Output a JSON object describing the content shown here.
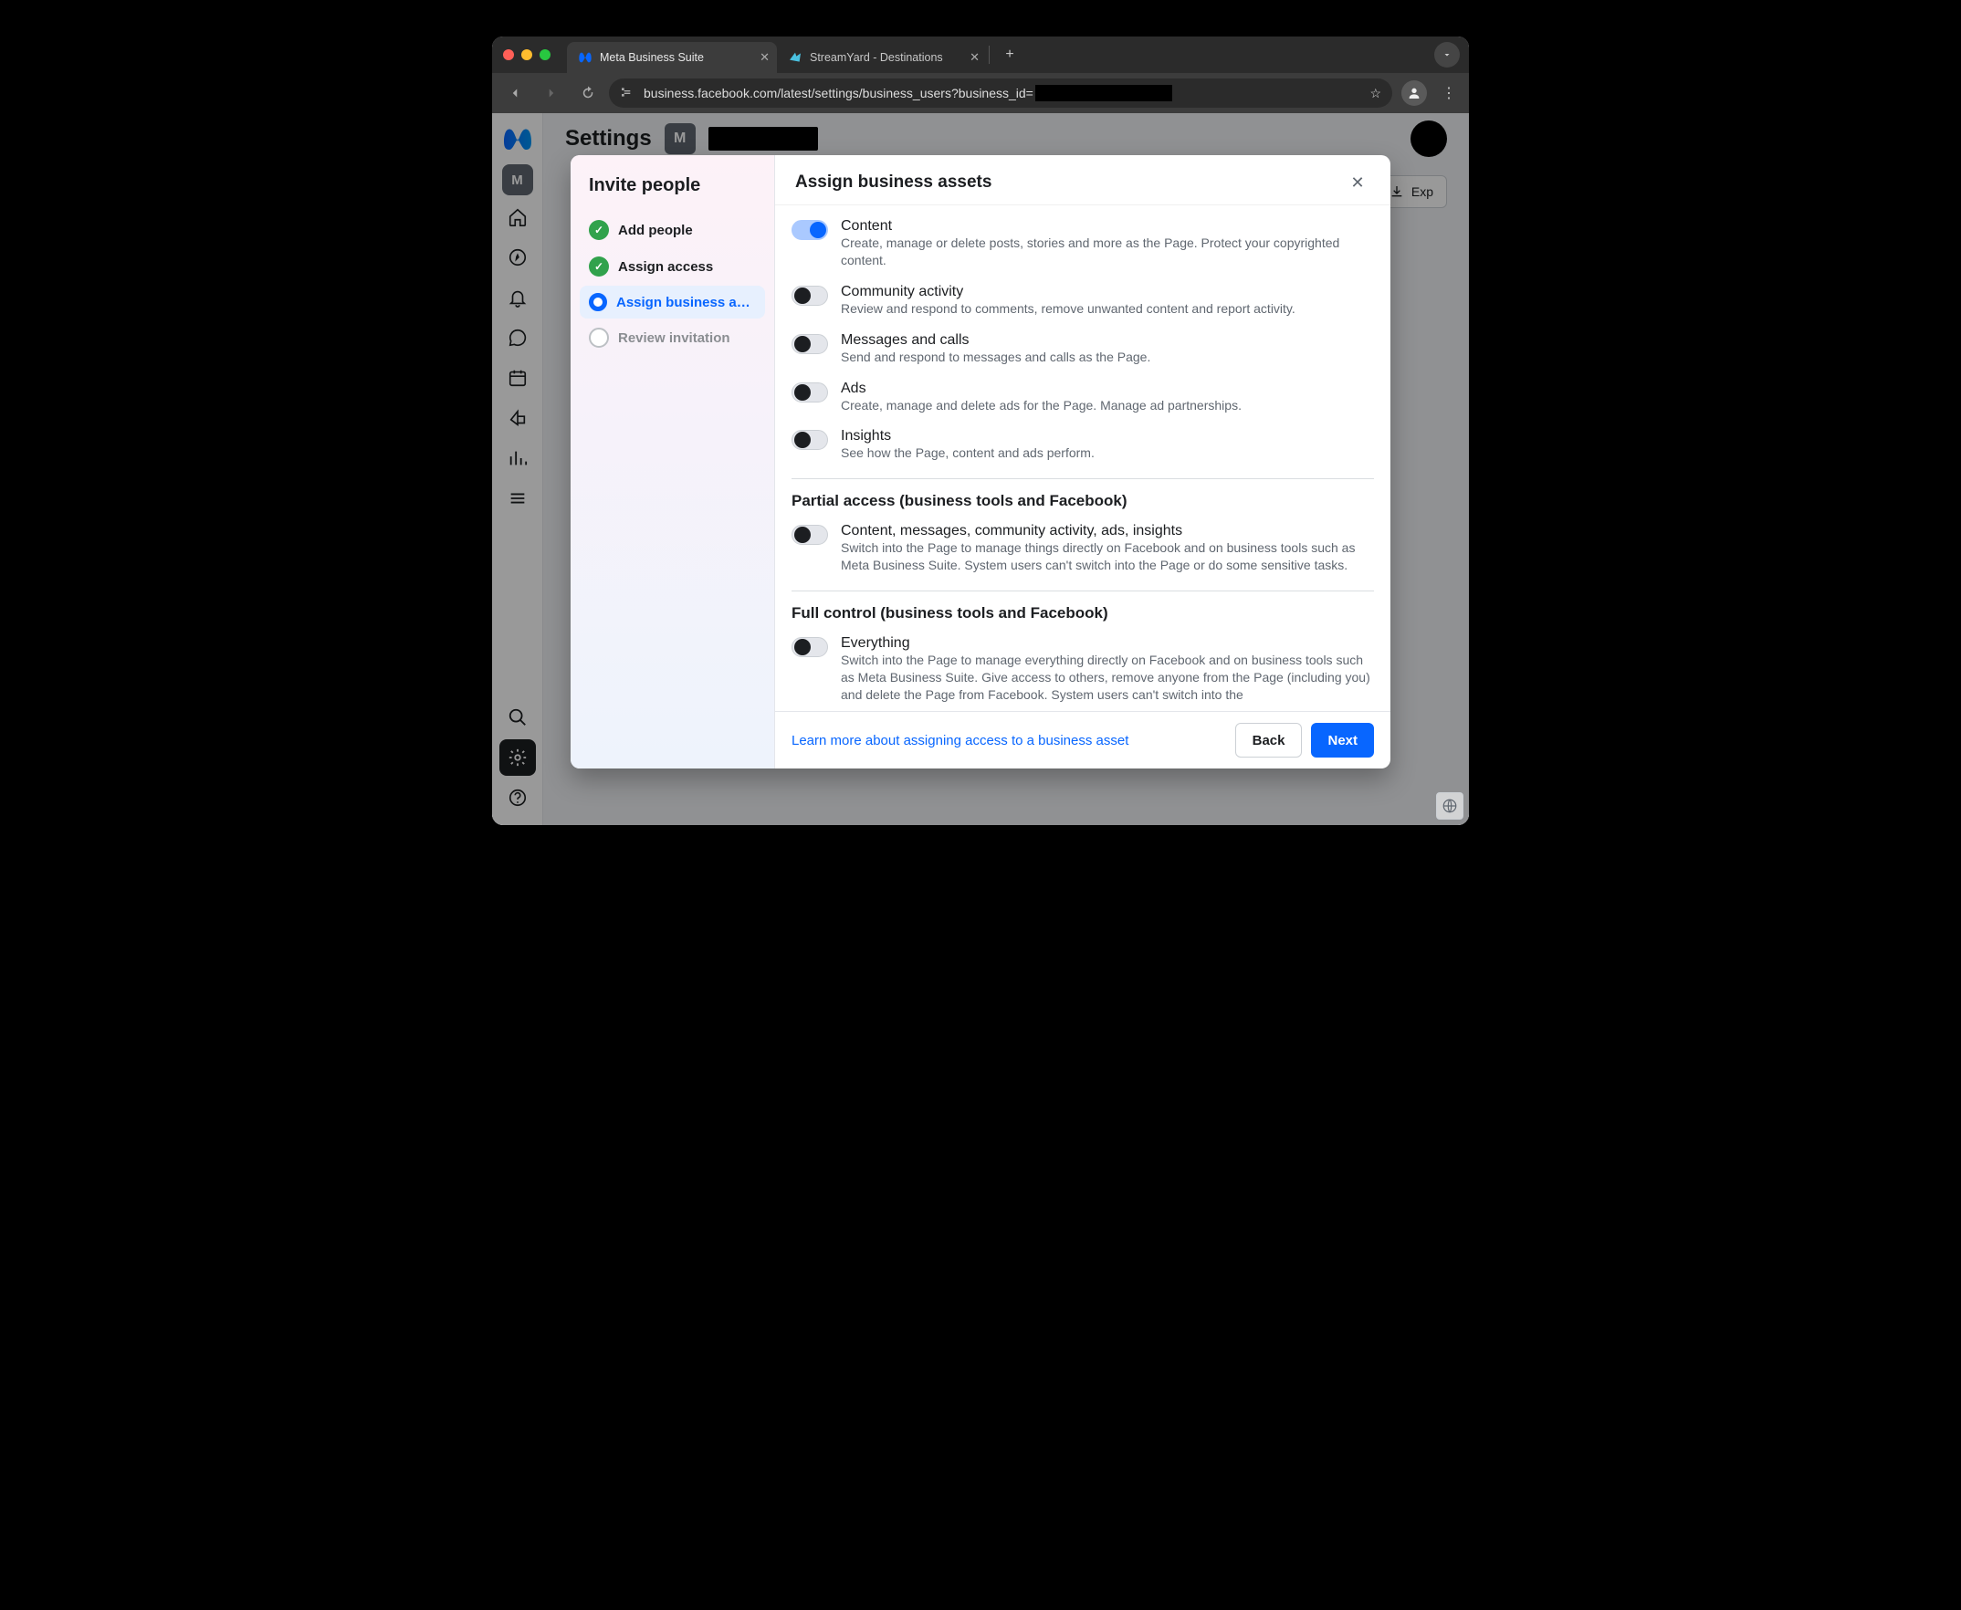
{
  "browser": {
    "tabs": [
      {
        "title": "Meta Business Suite",
        "active": true
      },
      {
        "title": "StreamYard - Destinations",
        "active": false
      }
    ],
    "url_prefix": "business.facebook.com/latest/settings/business_users?business_id="
  },
  "page": {
    "settings_title": "Settings",
    "page_badge": "M",
    "export_label": "Exp"
  },
  "sidebar": {
    "badge": "M"
  },
  "modal": {
    "sidebar_title": "Invite people",
    "title": "Assign business assets",
    "steps": [
      {
        "label": "Add people",
        "state": "done"
      },
      {
        "label": "Assign access",
        "state": "done"
      },
      {
        "label": "Assign business a…",
        "state": "current"
      },
      {
        "label": "Review invitation",
        "state": "pending"
      }
    ],
    "permissions": [
      {
        "key": "content",
        "title": "Content",
        "desc": "Create, manage or delete posts, stories and more as the Page. Protect your copyrighted content.",
        "on": true
      },
      {
        "key": "community",
        "title": "Community activity",
        "desc": "Review and respond to comments, remove unwanted content and report activity.",
        "on": false
      },
      {
        "key": "messages",
        "title": "Messages and calls",
        "desc": "Send and respond to messages and calls as the Page.",
        "on": false
      },
      {
        "key": "ads",
        "title": "Ads",
        "desc": "Create, manage and delete ads for the Page. Manage ad partnerships.",
        "on": false
      },
      {
        "key": "insights",
        "title": "Insights",
        "desc": "See how the Page, content and ads perform.",
        "on": false
      }
    ],
    "sections": [
      {
        "title": "Partial access (business tools and Facebook)",
        "perm": {
          "key": "partial",
          "title": "Content, messages, community activity, ads, insights",
          "desc": "Switch into the Page to manage things directly on Facebook and on business tools such as Meta Business Suite. System users can't switch into the Page or do some sensitive tasks.",
          "on": false
        }
      },
      {
        "title": "Full control (business tools and Facebook)",
        "perm": {
          "key": "full",
          "title": "Everything",
          "desc": "Switch into the Page to manage everything directly on Facebook and on business tools such as Meta Business Suite. Give access to others, remove anyone from the Page (including you) and delete the Page from Facebook. System users can't switch into the",
          "on": false
        }
      }
    ],
    "footer": {
      "learn_more": "Learn more about assigning access to a business asset",
      "back": "Back",
      "next": "Next"
    }
  }
}
